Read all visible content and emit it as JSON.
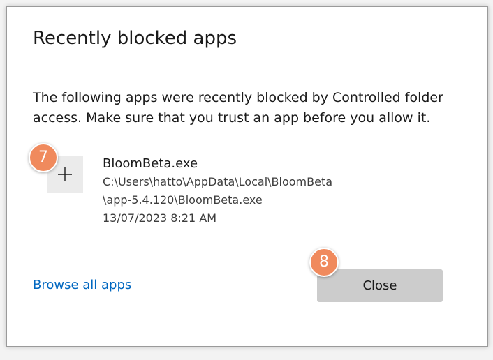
{
  "dialog": {
    "title": "Recently blocked apps",
    "description": "The following apps were recently blocked by Controlled folder access. Make sure that you trust an app before you allow it."
  },
  "blocked_app": {
    "icon": "plus-icon",
    "name": "BloomBeta.exe",
    "path_line1": "C:\\Users\\hatto\\AppData\\Local\\BloomBeta",
    "path_line2": "\\app-5.4.120\\BloomBeta.exe",
    "timestamp": "13/07/2023 8:21 AM"
  },
  "footer": {
    "browse_link": "Browse all apps",
    "close_label": "Close"
  },
  "annotations": {
    "step_7": "7",
    "step_8": "8"
  },
  "colors": {
    "link": "#0067c0",
    "button_bg": "#cccccc",
    "badge": "#f08a5d",
    "tile_bg": "#ebebeb"
  }
}
